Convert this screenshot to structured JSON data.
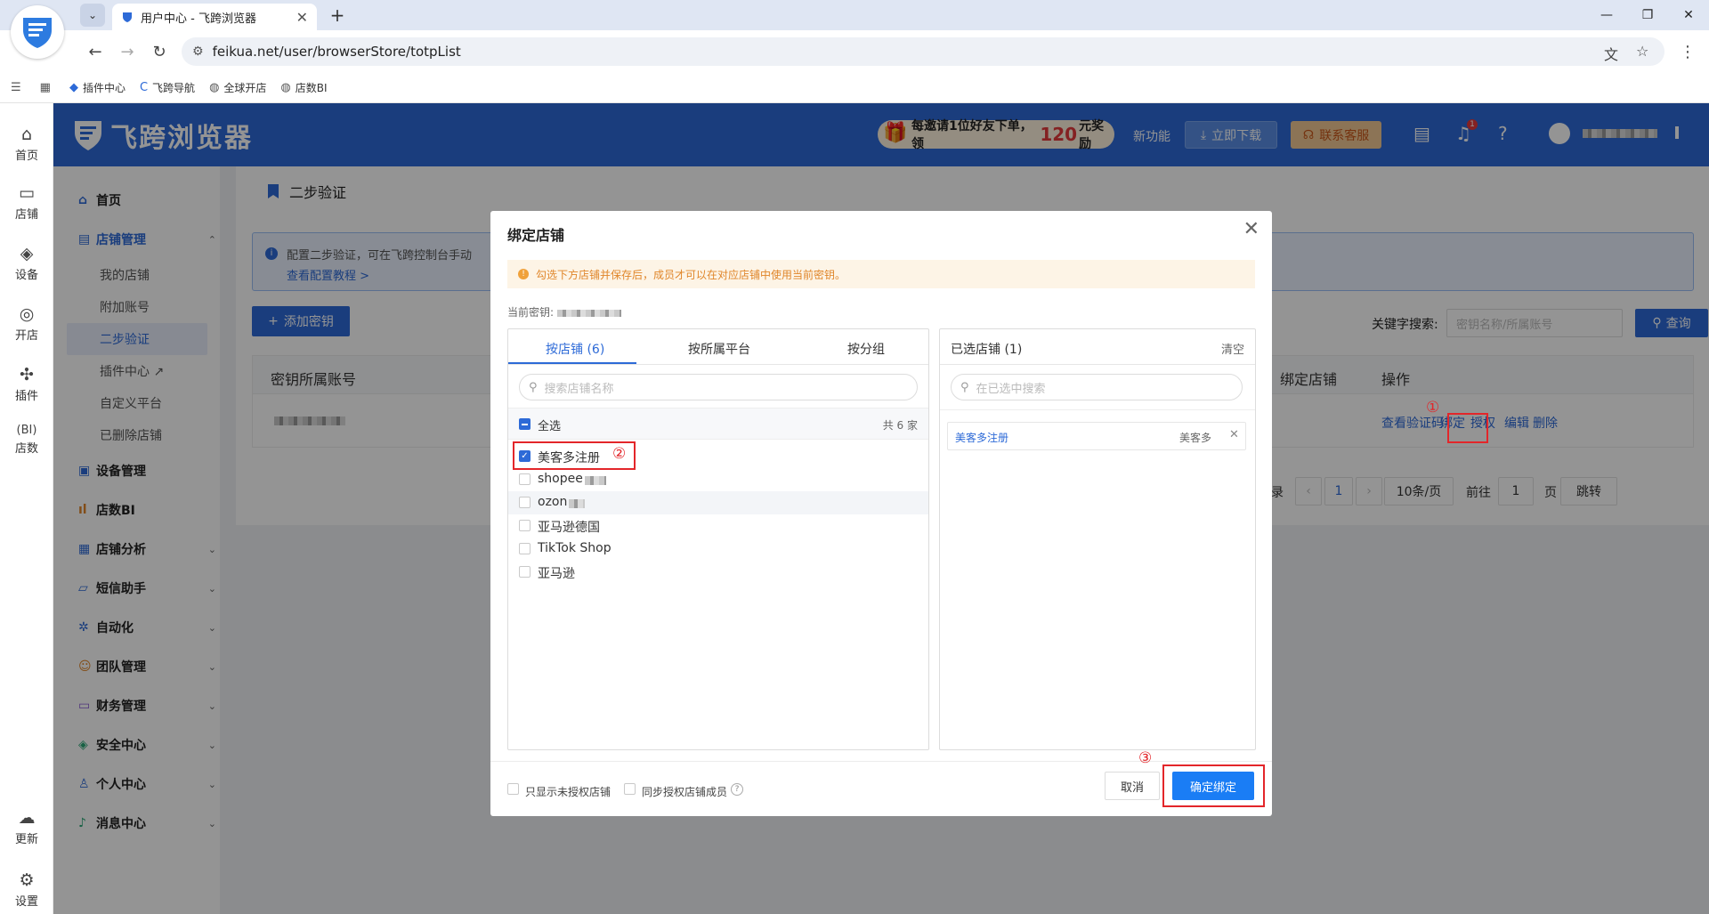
{
  "browser": {
    "tab_title": "用户中心 - 飞跨浏览器",
    "url": "feikua.net/user/browserStore/totpList",
    "bookmarks": [
      "插件中心",
      "飞跨导航",
      "全球开店",
      "店数BI"
    ]
  },
  "rail": [
    "首页",
    "店铺",
    "设备",
    "开店",
    "插件",
    "店数",
    "更新",
    "设置"
  ],
  "header": {
    "brand": "飞跨浏览器",
    "promo_prefix": "每邀请1位好友下单，领",
    "promo_amount": "120",
    "promo_suffix": "元奖励",
    "new_feature": "新功能",
    "download": "立即下载",
    "contact": "联系客服",
    "notif_count": "1"
  },
  "sidebar": {
    "home": "首页",
    "store_mgmt": "店铺管理",
    "sub_items": [
      "我的店铺",
      "附加账号",
      "二步验证",
      "插件中心",
      "自定义平台",
      "已删除店铺"
    ],
    "groups": [
      "设备管理",
      "店数BI",
      "店铺分析",
      "短信助手",
      "自动化",
      "团队管理",
      "财务管理",
      "安全中心",
      "个人中心",
      "消息中心"
    ]
  },
  "page": {
    "title": "二步验证",
    "info_text": "配置二步验证，可在飞跨控制台手动",
    "info_link": "查看配置教程 >",
    "add_btn": "添加密钥",
    "kw_label": "关键字搜索:",
    "kw_placeholder": "密钥名称/所属账号",
    "query_btn": "查询",
    "col_account": "密钥所属账号",
    "col_bound": "绑定店铺",
    "col_ops": "操作",
    "ops": [
      "查看验证码",
      "绑定",
      "授权",
      "编辑",
      "删除"
    ],
    "pager_total_suffix": "录",
    "pager_page": "1",
    "pager_size": "10条/页",
    "pager_goto": "前往",
    "pager_goto_value": "1",
    "pager_unit": "页",
    "pager_jump": "跳转"
  },
  "dialog": {
    "title": "绑定店铺",
    "warning": "勾选下方店铺并保存后，成员才可以在对应店铺中使用当前密钥。",
    "current_key_label": "当前密钥:",
    "tabs": [
      "按店铺 (6)",
      "按所属平台",
      "按分组"
    ],
    "search_placeholder": "搜索店铺名称",
    "select_all": "全选",
    "total": "共 6 家",
    "stores": [
      "美客多注册",
      "shopee",
      "ozon",
      "亚马逊德国",
      "TikTok Shop",
      "亚马逊"
    ],
    "selected_header": "已选店铺 (1)",
    "clear": "清空",
    "selected_search_placeholder": "在已选中搜索",
    "selected_item_name": "美客多注册",
    "selected_item_platform": "美客多",
    "only_unauthorized": "只显示未授权店铺",
    "sync_members": "同步授权店铺成员",
    "cancel": "取消",
    "confirm": "确定绑定"
  },
  "annotations": [
    "①",
    "②",
    "③"
  ]
}
